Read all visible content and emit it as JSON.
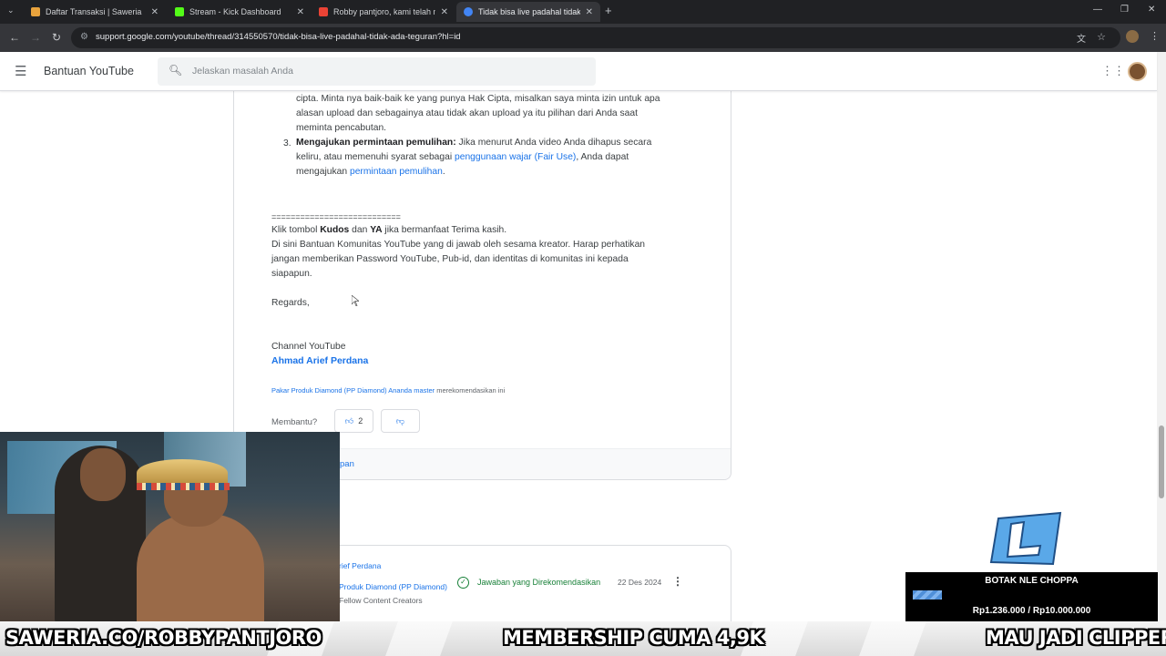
{
  "browser": {
    "tabs": [
      {
        "title": "Daftar Transaksi | Saweria",
        "favicon_color": "#e8a33d"
      },
      {
        "title": "Stream - Kick Dashboard",
        "favicon_color": "#53fc18"
      },
      {
        "title": "Robby pantjoro, kami telah me",
        "favicon_color": "#ea4335"
      },
      {
        "title": "Tidak bisa live padahal tidak ad",
        "favicon_color": "#4285f4"
      }
    ],
    "active_tab": 3,
    "url": "support.google.com/youtube/thread/314550570/tidak-bisa-live-padahal-tidak-ada-teguran?hl=id"
  },
  "header": {
    "brand": "Bantuan YouTube",
    "search_placeholder": "Jelaskan masalah Anda"
  },
  "post": {
    "line1": "cipta. Minta nya baik-baik ke yang punya Hak Cipta, misalkan saya minta izin untuk apa",
    "line2": "alasan upload dan sebagainya atau tidak akan upload ya itu pilihan dari Anda saat",
    "line3": "meminta pencabutan.",
    "item3_number": "3.",
    "item3_bold": "Mengajukan permintaan pemulihan:",
    "item3_text": " Jika menurut Anda video Anda dihapus secara",
    "item3_line2_pre": "keliru, atau memenuhi syarat sebagai ",
    "item3_link1": "penggunaan wajar (Fair Use)",
    "item3_line2_post": ", Anda dapat",
    "item3_line3_pre": "mengajukan ",
    "item3_link2": "permintaan pemulihan",
    "item3_line3_post": ".",
    "divider": "===========================",
    "kudos_pre": "Klik tombol ",
    "kudos_bold": "Kudos",
    "kudos_mid": " dan ",
    "kudos_bold2": "YA",
    "kudos_post": " jika bermanfaat Terima kasih.",
    "note1": "Di sini Bantuan Komunitas YouTube yang di jawab oleh sesama kreator. Harap perhatikan",
    "note2": "jangan memberikan Password YouTube, Pub-id, dan identitas di komunitas ini kepada",
    "note3": "siapapun.",
    "regards": "Regards,",
    "channel_label": "Channel YouTube",
    "author": "Ahmad Arief Perdana",
    "rec_link": "Pakar Produk Diamond (PP Diamond) Ananda master",
    "rec_text": " merekomendasikan ini",
    "helpful_label": "Membantu?",
    "upvote_count": "2",
    "footer_link": "pan"
  },
  "reply": {
    "name": "rief Perdana",
    "badge": "Produk Diamond (PP Diamond)",
    "sub": "Fellow Content Creators",
    "recommended": "Jawaban yang Direkomendasikan",
    "date": "22 Des 2024"
  },
  "overlay": {
    "ticker1": "SAWERIA.CO/ROBBYPANTJORO",
    "ticker2": "MEMBERSHIP CUMA 4,9K",
    "ticker3": "MAU JADI CLIPPER?",
    "goal_title": "BOTAK NLE CHOPPA",
    "goal_amount": "Rp1.236.000 / Rp10.000.000",
    "goal_progress": 0.1236
  }
}
